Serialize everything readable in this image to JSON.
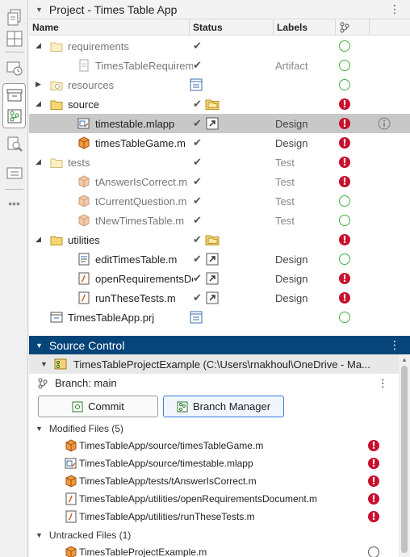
{
  "project_panel": {
    "title": "Project - Times Table App",
    "columns": [
      "Name",
      "Status",
      "Labels"
    ],
    "rows": [
      {
        "name": "requirements",
        "label": "",
        "git": "ok",
        "indent": 0,
        "expanded": true,
        "kind": "folder-light"
      },
      {
        "name": "TimesTableRequirements",
        "label": "Artifact",
        "git": "ok",
        "indent": 1,
        "kind": "file-dim"
      },
      {
        "name": "resources",
        "label": "",
        "git": "ok",
        "indent": 0,
        "expanded": false,
        "kind": "folder-res"
      },
      {
        "name": "source",
        "label": "",
        "git": "error",
        "indent": 0,
        "expanded": true,
        "kind": "folder"
      },
      {
        "name": "timestable.mlapp",
        "label": "Design",
        "git": "error",
        "indent": 1,
        "kind": "mlapp",
        "selected": true
      },
      {
        "name": "timesTableGame.m",
        "label": "Design",
        "git": "error",
        "indent": 1,
        "kind": "mfile"
      },
      {
        "name": "tests",
        "label": "Test",
        "git": "error",
        "indent": 0,
        "expanded": true,
        "kind": "folder-light"
      },
      {
        "name": "tAnswerIsCorrect.m",
        "label": "Test",
        "git": "error",
        "indent": 1,
        "kind": "test"
      },
      {
        "name": "tCurrentQuestion.m",
        "label": "Test",
        "git": "ok",
        "indent": 1,
        "kind": "test"
      },
      {
        "name": "tNewTimesTable.m",
        "label": "Test",
        "git": "ok",
        "indent": 1,
        "kind": "test"
      },
      {
        "name": "utilities",
        "label": "",
        "git": "error",
        "indent": 0,
        "expanded": true,
        "kind": "folder"
      },
      {
        "name": "editTimesTable.m",
        "label": "Design",
        "git": "ok",
        "indent": 1,
        "kind": "func"
      },
      {
        "name": "openRequirementsDocum",
        "label": "Design",
        "git": "error",
        "indent": 1,
        "kind": "script"
      },
      {
        "name": "runTheseTests.m",
        "label": "Design",
        "git": "error",
        "indent": 1,
        "kind": "script"
      },
      {
        "name": "TimesTableApp.prj",
        "label": "",
        "git": "ok",
        "indent": 0,
        "kind": "prj"
      }
    ]
  },
  "source_control": {
    "title": "Source Control",
    "repo": "TimesTableProjectExample (C:\\Users\\rnakhoul\\OneDrive - Ma...",
    "branch_label": "Branch: main",
    "commit_label": "Commit",
    "branch_manager_label": "Branch Manager",
    "modified_header": "Modified Files (5)",
    "modified_files": [
      {
        "path": "TimesTableApp/source/timesTableGame.m",
        "kind": "mfile"
      },
      {
        "path": "TimesTableApp/source/timestable.mlapp",
        "kind": "mlapp"
      },
      {
        "path": "TimesTableApp/tests/tAnswerIsCorrect.m",
        "kind": "mfile"
      },
      {
        "path": "TimesTableApp/utilities/openRequirementsDocument.m",
        "kind": "script"
      },
      {
        "path": "TimesTableApp/utilities/runTheseTests.m",
        "kind": "script"
      }
    ],
    "untracked_header": "Untracked Files (1)",
    "untracked_files": [
      {
        "path": "TimesTableProjectExample.m",
        "kind": "mfile"
      }
    ]
  },
  "colors": {
    "accent": "#06457a",
    "ok": "#43b043",
    "error": "#c8102e",
    "folder": "#e8c44a"
  }
}
